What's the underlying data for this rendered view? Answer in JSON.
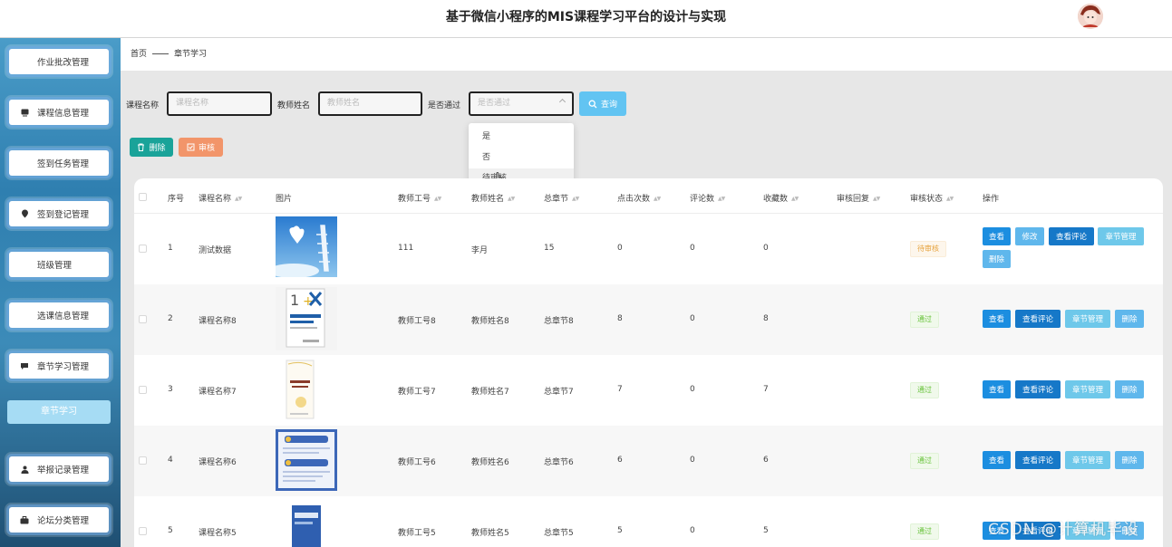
{
  "header": {
    "title": "基于微信小程序的MIS课程学习平台的设计与实现"
  },
  "sidebar": {
    "items": [
      {
        "label": "作业批改管理",
        "icon": "grid-icon"
      },
      {
        "label": "课程信息管理",
        "icon": "monitor-icon"
      },
      {
        "label": "签到任务管理",
        "icon": "grid-icon"
      },
      {
        "label": "签到登记管理",
        "icon": "pin-icon"
      },
      {
        "label": "班级管理",
        "icon": "grid-icon"
      },
      {
        "label": "选课信息管理",
        "icon": "grid-icon"
      },
      {
        "label": "章节学习管理",
        "icon": "chat-icon"
      },
      {
        "label": "举报记录管理",
        "icon": "user-icon"
      },
      {
        "label": "论坛分类管理",
        "icon": "briefcase-icon"
      }
    ],
    "active_sub": "章节学习"
  },
  "breadcrumb": {
    "home": "首页",
    "current": "章节学习"
  },
  "filters": {
    "course_label": "课程名称",
    "course_placeholder": "课程名称",
    "teacher_label": "教师姓名",
    "teacher_placeholder": "教师姓名",
    "passed_label": "是否通过",
    "passed_placeholder": "是否通过",
    "search_label": "查询",
    "options": [
      "是",
      "否",
      "待审核"
    ]
  },
  "toolbar": {
    "delete_label": "删除",
    "review_label": "审核"
  },
  "table": {
    "headers": [
      "序号",
      "课程名称",
      "图片",
      "教师工号",
      "教师姓名",
      "总章节",
      "点击次数",
      "评论数",
      "收藏数",
      "审核回复",
      "审核状态",
      "操作"
    ],
    "rows": [
      {
        "no": "1",
        "course": "测试数据",
        "teacher_id": "111",
        "teacher": "李月",
        "chapters": "15",
        "clicks": "0",
        "comments": "0",
        "favorites": "0",
        "reply": "",
        "status": "待审核",
        "actions": [
          "查看",
          "修改",
          "查看评论",
          "章节管理",
          "删除"
        ]
      },
      {
        "no": "2",
        "course": "课程名称8",
        "teacher_id": "教师工号8",
        "teacher": "教师姓名8",
        "chapters": "总章节8",
        "clicks": "8",
        "comments": "0",
        "favorites": "8",
        "reply": "",
        "status": "通过",
        "actions": [
          "查看",
          "查看评论",
          "章节管理",
          "删除"
        ]
      },
      {
        "no": "3",
        "course": "课程名称7",
        "teacher_id": "教师工号7",
        "teacher": "教师姓名7",
        "chapters": "总章节7",
        "clicks": "7",
        "comments": "0",
        "favorites": "7",
        "reply": "",
        "status": "通过",
        "actions": [
          "查看",
          "查看评论",
          "章节管理",
          "删除"
        ]
      },
      {
        "no": "4",
        "course": "课程名称6",
        "teacher_id": "教师工号6",
        "teacher": "教师姓名6",
        "chapters": "总章节6",
        "clicks": "6",
        "comments": "0",
        "favorites": "6",
        "reply": "",
        "status": "通过",
        "actions": [
          "查看",
          "查看评论",
          "章节管理",
          "删除"
        ]
      },
      {
        "no": "5",
        "course": "课程名称5",
        "teacher_id": "教师工号5",
        "teacher": "教师姓名5",
        "chapters": "总章节5",
        "clicks": "5",
        "comments": "0",
        "favorites": "5",
        "reply": "",
        "status": "通过",
        "actions": [
          "查看",
          "查看评论",
          "章节管理",
          "删除"
        ]
      }
    ]
  },
  "watermark": "CSDN @计算机毕设",
  "colors": {
    "primary": "#1c8ee0",
    "teal": "#1aa399",
    "orange": "#f2956a",
    "search": "#62c4f2"
  }
}
